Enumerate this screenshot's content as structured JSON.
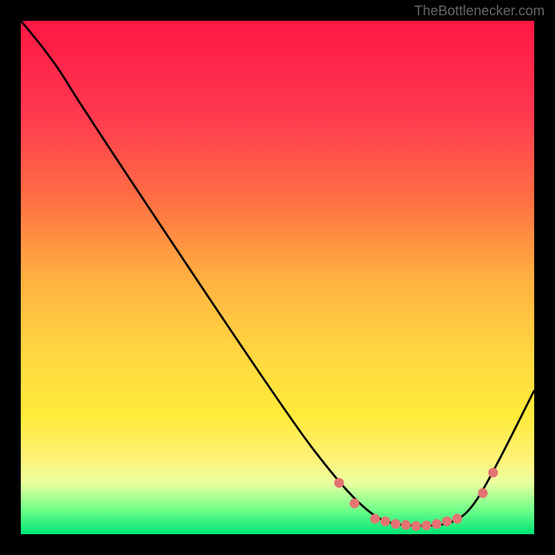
{
  "watermark": "TheBottlenecker.com",
  "chart_data": {
    "type": "line",
    "title": "",
    "xlabel": "",
    "ylabel": "",
    "xlim": [
      0,
      100
    ],
    "ylim": [
      0,
      100
    ],
    "gradient_stops": [
      {
        "offset": 0,
        "color": "#ff1744"
      },
      {
        "offset": 18,
        "color": "#ff3850"
      },
      {
        "offset": 35,
        "color": "#ff7043"
      },
      {
        "offset": 50,
        "color": "#ffb040"
      },
      {
        "offset": 65,
        "color": "#ffd740"
      },
      {
        "offset": 77,
        "color": "#ffeb3b"
      },
      {
        "offset": 85,
        "color": "#fff176"
      },
      {
        "offset": 90,
        "color": "#eaffa0"
      },
      {
        "offset": 95,
        "color": "#76ff8a"
      },
      {
        "offset": 100,
        "color": "#00e676"
      }
    ],
    "curve_points": [
      {
        "x": 0,
        "y": 100
      },
      {
        "x": 6,
        "y": 93
      },
      {
        "x": 12,
        "y": 83
      },
      {
        "x": 52,
        "y": 23
      },
      {
        "x": 62,
        "y": 10
      },
      {
        "x": 68,
        "y": 4
      },
      {
        "x": 72,
        "y": 2
      },
      {
        "x": 78,
        "y": 1.5
      },
      {
        "x": 84,
        "y": 2
      },
      {
        "x": 88,
        "y": 5
      },
      {
        "x": 93,
        "y": 14
      },
      {
        "x": 100,
        "y": 28
      }
    ],
    "marker_points": [
      {
        "x": 62,
        "y": 10
      },
      {
        "x": 65,
        "y": 6
      },
      {
        "x": 69,
        "y": 3
      },
      {
        "x": 71,
        "y": 2.5
      },
      {
        "x": 73,
        "y": 2
      },
      {
        "x": 75,
        "y": 1.8
      },
      {
        "x": 77,
        "y": 1.6
      },
      {
        "x": 79,
        "y": 1.7
      },
      {
        "x": 81,
        "y": 2
      },
      {
        "x": 83,
        "y": 2.5
      },
      {
        "x": 85,
        "y": 3
      },
      {
        "x": 90,
        "y": 8
      },
      {
        "x": 92,
        "y": 12
      }
    ],
    "marker_color": "#e57373",
    "line_color": "#000000"
  }
}
